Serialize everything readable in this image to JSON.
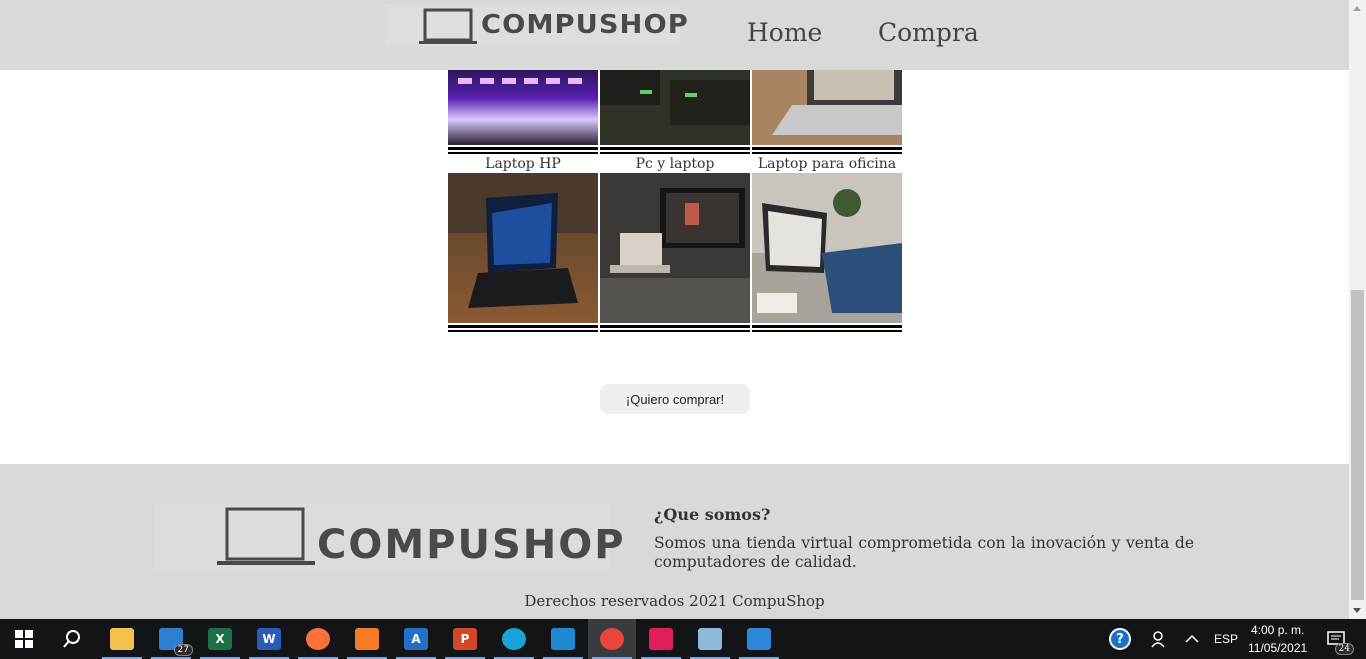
{
  "header": {
    "logo_text": "COMPUSHOP",
    "nav": [
      {
        "label": "Home"
      },
      {
        "label": "Compra"
      }
    ]
  },
  "gallery": {
    "captions": [
      "Laptop HP",
      "Pc y laptop",
      "Laptop para oficina"
    ]
  },
  "buy_button": {
    "label": "¡Quiero comprar!"
  },
  "footer": {
    "logo_text": "COMPUSHOP",
    "title": "¿Que somos?",
    "description": "Somos una tienda virtual comprometida con la inovación y venta de computadores de calidad.",
    "copyright": "Derechos reservados 2021 CompuShop"
  },
  "taskbar": {
    "apps": [
      {
        "name": "file-explorer-icon",
        "color": "#f2c14e"
      },
      {
        "name": "mail-icon",
        "color": "#2f7fd1",
        "badge": "27"
      },
      {
        "name": "excel-icon",
        "color": "#1d7044",
        "letter": "X"
      },
      {
        "name": "word-icon",
        "color": "#2b5bb8",
        "letter": "W"
      },
      {
        "name": "firefox-icon",
        "color": "#ff7139"
      },
      {
        "name": "xampp-icon",
        "color": "#f57c20"
      },
      {
        "name": "arduino-ide-icon",
        "color": "#2470c9",
        "letter": "A"
      },
      {
        "name": "powerpoint-icon",
        "color": "#d24726",
        "letter": "P"
      },
      {
        "name": "edge-icon",
        "color": "#1aa3d9"
      },
      {
        "name": "vscode-icon",
        "color": "#1f8ad2"
      },
      {
        "name": "chrome-icon",
        "color": "#e8453c"
      },
      {
        "name": "slack-icon",
        "color": "#e01e5a"
      },
      {
        "name": "virtualbox-icon",
        "color": "#8fb9d8"
      },
      {
        "name": "photos-icon",
        "color": "#2d87d6"
      }
    ],
    "language": "ESP",
    "time": "4:00 p. m.",
    "date": "11/05/2021",
    "notification_count": "24"
  }
}
